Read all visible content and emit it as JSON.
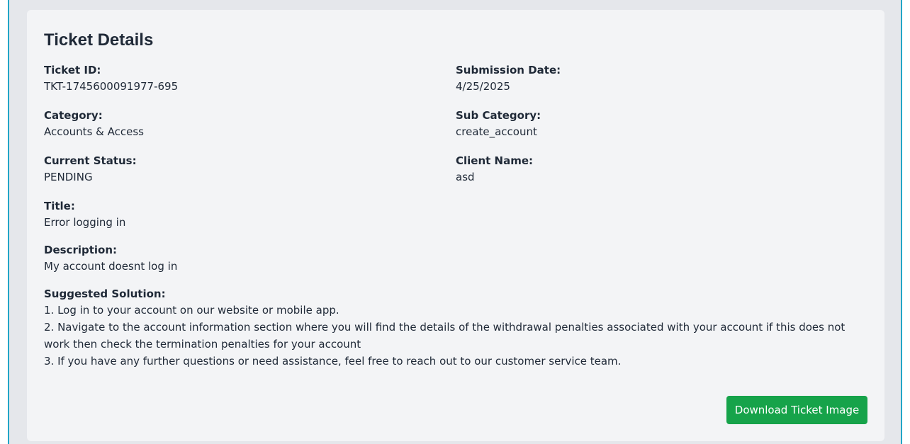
{
  "card": {
    "title": "Ticket Details"
  },
  "fields": {
    "ticket_id": {
      "label": "Ticket ID:",
      "value": "TKT-1745600091977-695"
    },
    "submission_date": {
      "label": "Submission Date:",
      "value": "4/25/2025"
    },
    "category": {
      "label": "Category:",
      "value": "Accounts & Access"
    },
    "sub_category": {
      "label": "Sub Category:",
      "value": "create_account"
    },
    "current_status": {
      "label": "Current Status:",
      "value": "PENDING"
    },
    "client_name": {
      "label": "Client Name:",
      "value": "asd"
    },
    "title": {
      "label": "Title:",
      "value": "Error logging in"
    },
    "description": {
      "label": "Description:",
      "value": "My account doesnt log in"
    }
  },
  "suggested_solution": {
    "label": "Suggested Solution:",
    "lines": [
      "1. Log in to your account on our website or mobile app.",
      "2. Navigate to the account information section where you will find the details of the withdrawal penalties associated with your account if this does not work then check the termination penalties for your account",
      "3. If you have any further questions or need assistance, feel free to reach out to our customer service team."
    ]
  },
  "actions": {
    "download_label": "Download Ticket Image"
  },
  "colors": {
    "accent_border": "#22a6c7",
    "button_bg": "#16a34a",
    "card_bg": "#f3f4f6",
    "page_bg": "#e5e7eb"
  }
}
